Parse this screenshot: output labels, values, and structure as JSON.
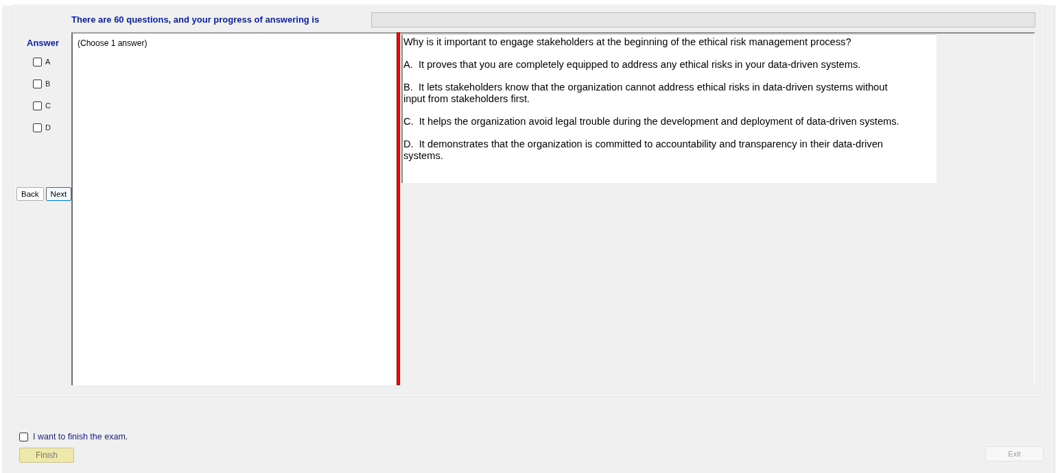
{
  "header": {
    "progress_label": "There are 60 questions, and your progress of answering is",
    "progress": {
      "level": 0
    }
  },
  "answer_panel": {
    "title": "Answer",
    "options": [
      {
        "label": "A",
        "checked": false
      },
      {
        "label": "B",
        "checked": false
      },
      {
        "label": "C",
        "checked": false
      },
      {
        "label": "D",
        "checked": false
      }
    ],
    "buttons": [
      {
        "label": "Back",
        "focused": false
      },
      {
        "label": "Next",
        "focused": true
      }
    ]
  },
  "answer_box": {
    "value": "(Choose 1 answer)"
  },
  "question": {
    "prompt": "Why is it important to engage stakeholders at the beginning of the ethical risk management process?",
    "choices": [
      "A.  It proves that you are completely equipped to address any ethical risks in your data-driven systems.",
      "B.  It lets stakeholders know that the organization cannot address ethical risks in data-driven systems without input from stakeholders first.",
      "C.  It helps the organization avoid legal trouble during the development and deployment of data-driven systems.",
      "D.  It demonstrates that the organization is committed to accountability and transparency in their data-driven systems."
    ]
  },
  "footer": {
    "confirm": {
      "label": "I want to finish the exam.",
      "checked": false
    },
    "finish_button": {
      "label": "Finish",
      "disabled": true
    },
    "exit_button": {
      "label": "Exit",
      "disabled": true
    }
  }
}
